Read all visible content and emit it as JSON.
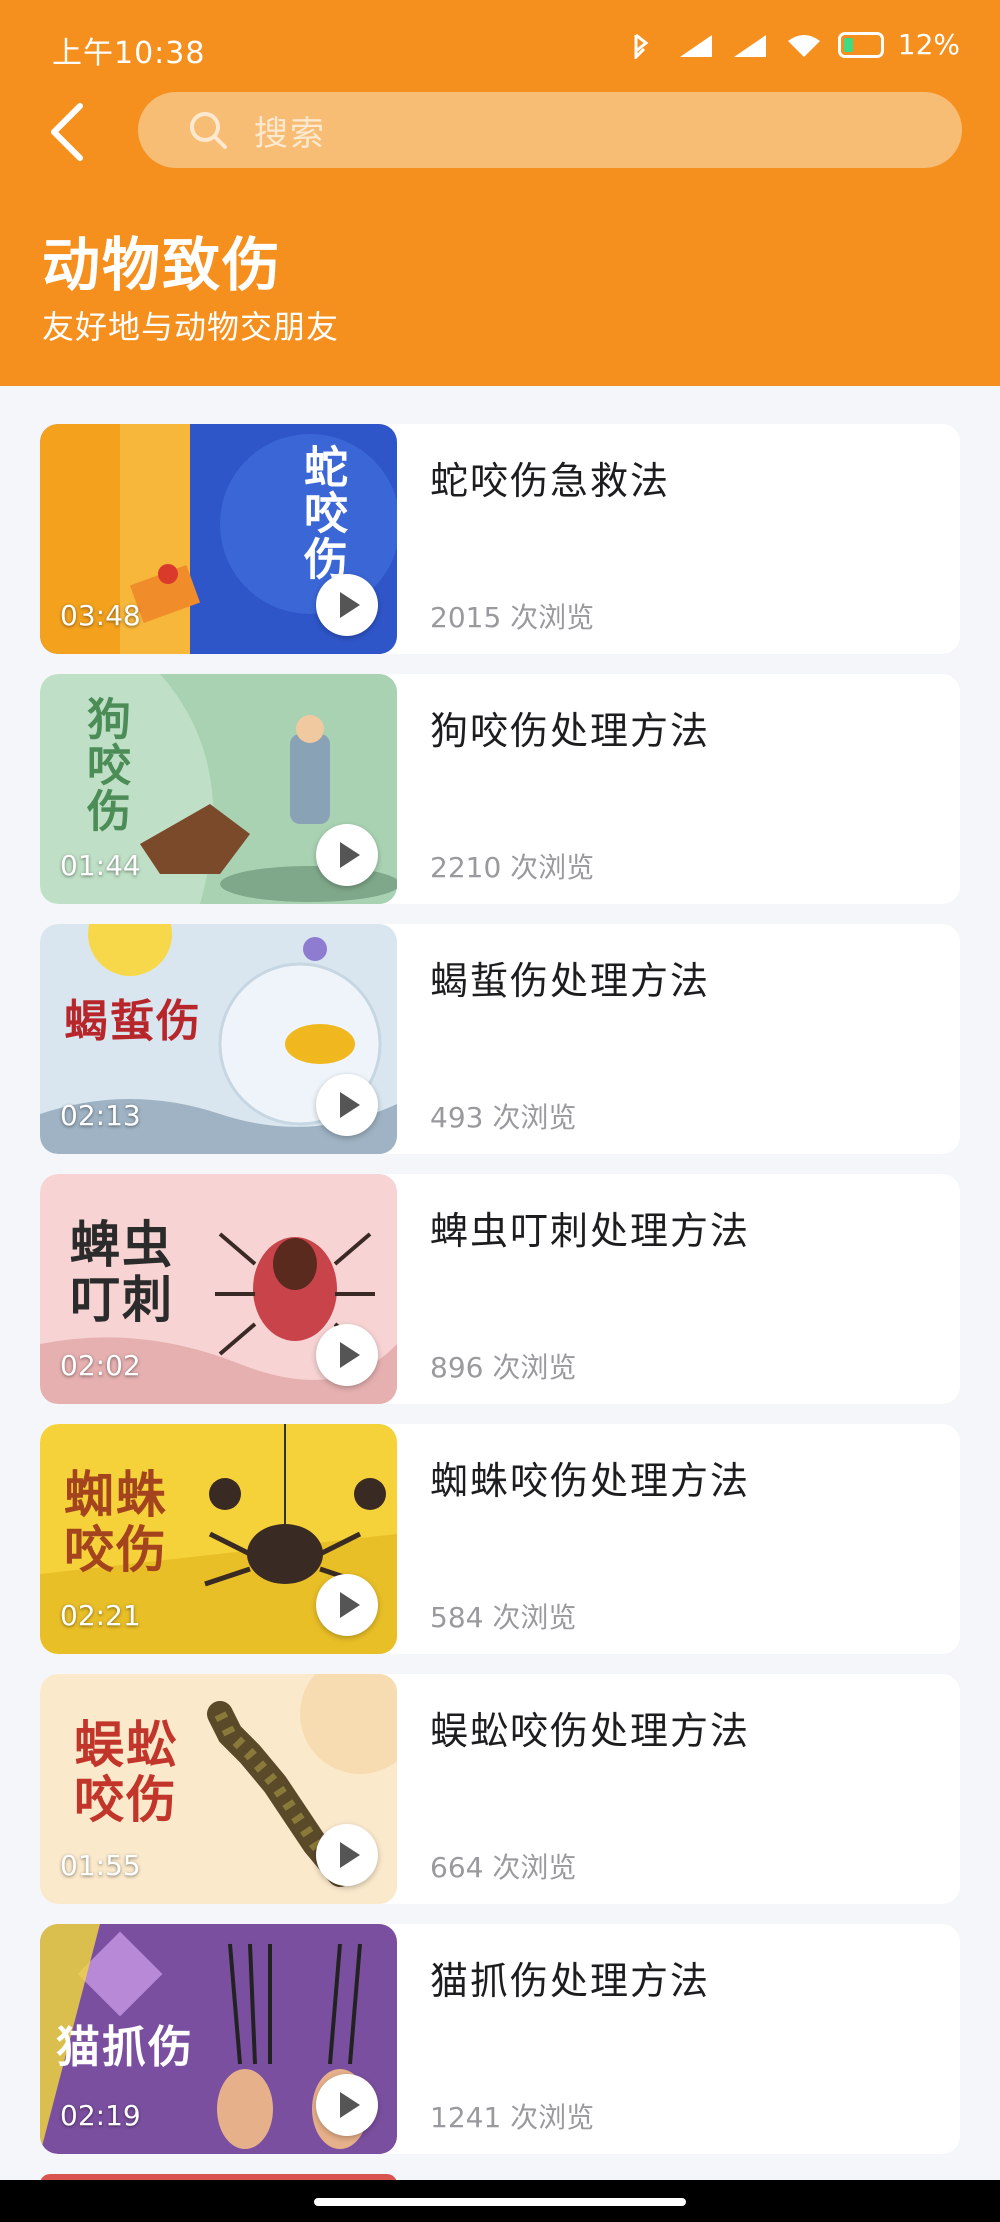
{
  "status": {
    "time": "上午10:38",
    "battery": "12%"
  },
  "search": {
    "placeholder": "搜索"
  },
  "page": {
    "title": "动物致伤",
    "subtitle": "友好地与动物交朋友"
  },
  "items": [
    {
      "title": "蛇咬伤急救法",
      "views": "2015 次浏览",
      "duration": "03:48",
      "thumb_text": "蛇咬伤"
    },
    {
      "title": "狗咬伤处理方法",
      "views": "2210 次浏览",
      "duration": "01:44",
      "thumb_text": "狗咬伤"
    },
    {
      "title": "蝎蜇伤处理方法",
      "views": "493 次浏览",
      "duration": "02:13",
      "thumb_text": "蝎蜇伤"
    },
    {
      "title": "蜱虫叮刺处理方法",
      "views": "896 次浏览",
      "duration": "02:02",
      "thumb_text": "蜱虫叮刺"
    },
    {
      "title": "蜘蛛咬伤处理方法",
      "views": "584 次浏览",
      "duration": "02:21",
      "thumb_text": "蜘蛛咬伤"
    },
    {
      "title": "蜈蚣咬伤处理方法",
      "views": "664 次浏览",
      "duration": "01:55",
      "thumb_text": "蜈蚣咬伤"
    },
    {
      "title": "猫抓伤处理方法",
      "views": "1241 次浏览",
      "duration": "02:19",
      "thumb_text": "猫抓伤"
    }
  ],
  "colors": {
    "header": "#f5901f",
    "search_bg": "#f7bd75",
    "page_bg": "#f4f6f9"
  },
  "icons": {
    "back": "chevron-left-icon",
    "search": "search-icon",
    "play": "play-icon"
  }
}
